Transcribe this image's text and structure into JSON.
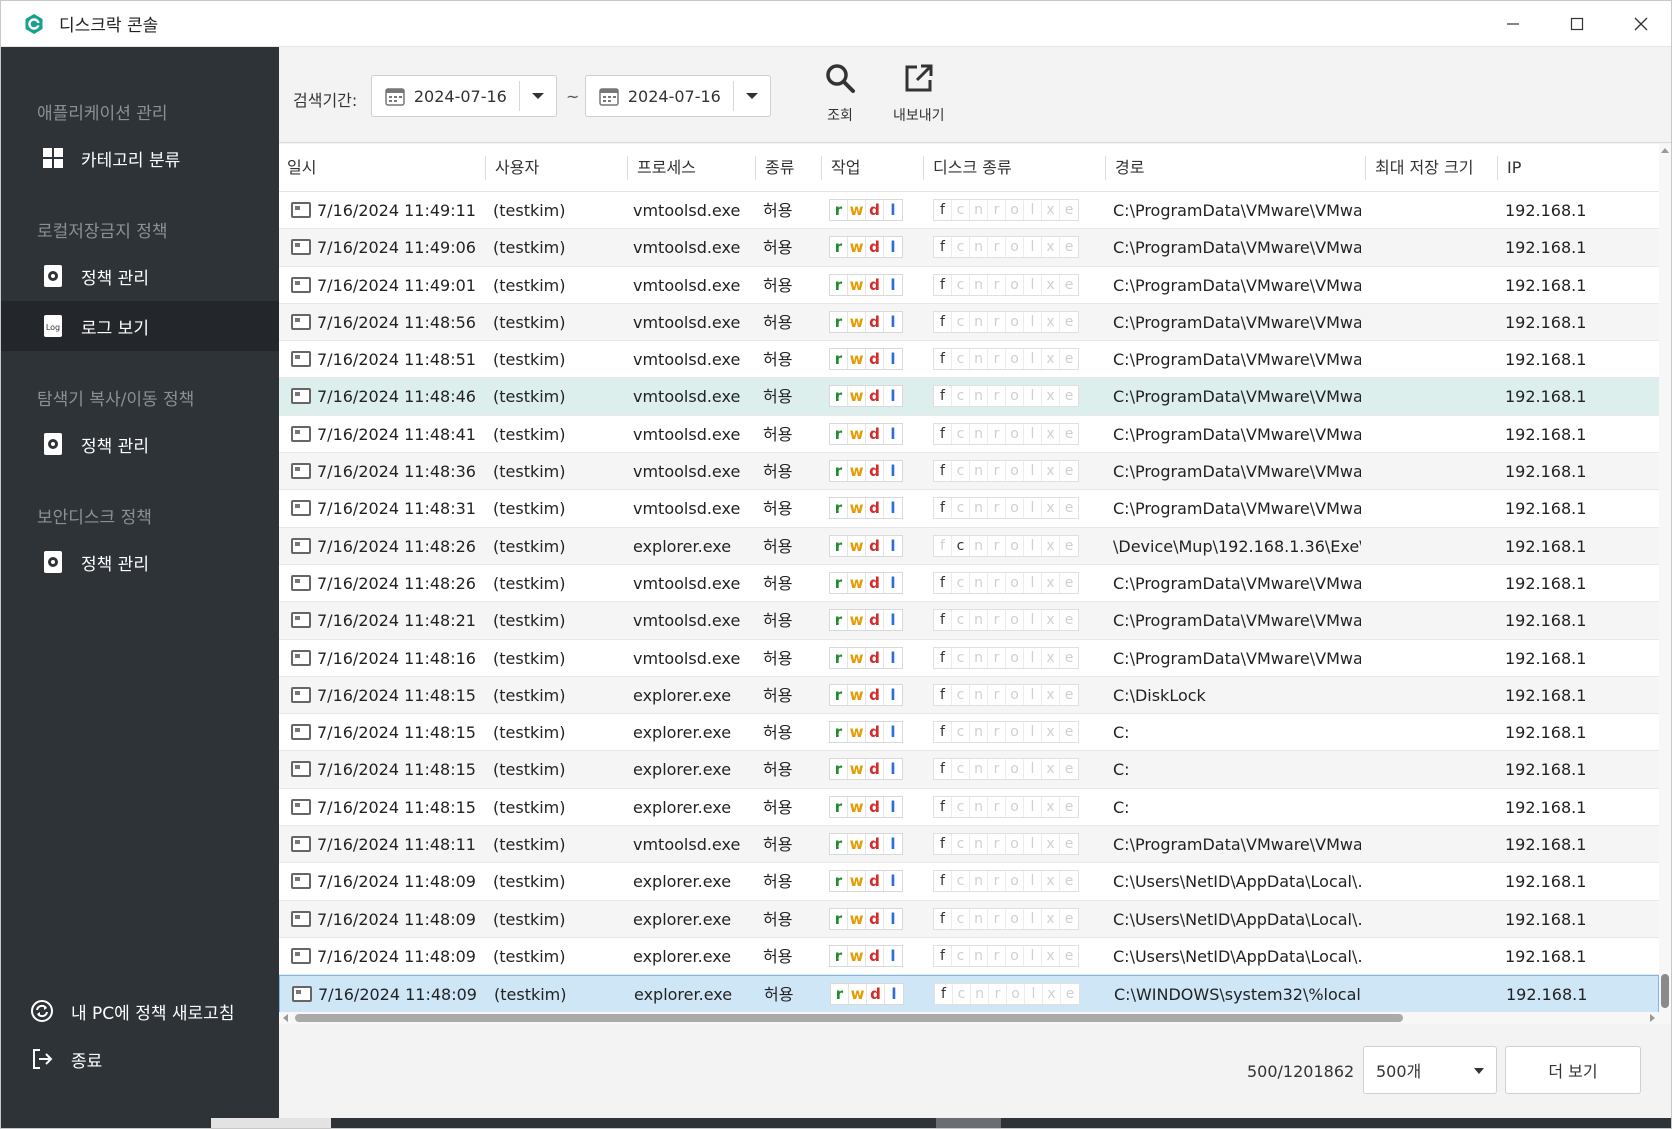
{
  "window": {
    "title": "디스크락 콘솔",
    "accent": "#1aa08f"
  },
  "sidebar": {
    "sections": [
      {
        "label": "애플리케이션 관리",
        "items": [
          {
            "label": "카테고리 분류",
            "icon": "grid-icon"
          }
        ]
      },
      {
        "label": "로컬저장금지 정책",
        "items": [
          {
            "label": "정책 관리",
            "icon": "gear-doc-icon"
          },
          {
            "label": "로그 보기",
            "icon": "log-icon",
            "active": true
          }
        ]
      },
      {
        "label": "탐색기 복사/이동 정책",
        "items": [
          {
            "label": "정책 관리",
            "icon": "gear-doc-icon"
          }
        ]
      },
      {
        "label": "보안디스크 정책",
        "items": [
          {
            "label": "정책 관리",
            "icon": "gear-doc-icon"
          }
        ]
      }
    ],
    "log_icon_text": "Log",
    "footer": [
      {
        "label": "내 PC에 정책 새로고침",
        "icon": "refresh-icon"
      },
      {
        "label": "종료",
        "icon": "exit-icon"
      }
    ]
  },
  "toolbar": {
    "period_label": "검색기간:",
    "start_date": "2024-07-16",
    "end_date": "2024-07-16",
    "tilde": "~",
    "search_label": "조회",
    "export_label": "내보내기"
  },
  "table": {
    "columns": [
      "일시",
      "사용자",
      "프로세스",
      "종류",
      "작업",
      "디스크 종류",
      "경로",
      "최대 저장 크기",
      "IP"
    ],
    "ops_letters": [
      "r",
      "w",
      "d",
      "l"
    ],
    "disk_letters": [
      "f",
      "c",
      "n",
      "r",
      "o",
      "l",
      "x",
      "e"
    ],
    "rows": [
      {
        "time": "7/16/2024 11:49:11…",
        "user": "(testkim)",
        "process": "vmtoolsd.exe",
        "kind": "허용",
        "disk_on": [
          0
        ],
        "path": "C:\\ProgramData\\VMware\\VMwa…",
        "ip": "192.168.1"
      },
      {
        "time": "7/16/2024 11:49:06…",
        "user": "(testkim)",
        "process": "vmtoolsd.exe",
        "kind": "허용",
        "disk_on": [
          0
        ],
        "path": "C:\\ProgramData\\VMware\\VMwa…",
        "ip": "192.168.1"
      },
      {
        "time": "7/16/2024 11:49:01…",
        "user": "(testkim)",
        "process": "vmtoolsd.exe",
        "kind": "허용",
        "disk_on": [
          0
        ],
        "path": "C:\\ProgramData\\VMware\\VMwa…",
        "ip": "192.168.1"
      },
      {
        "time": "7/16/2024 11:48:56…",
        "user": "(testkim)",
        "process": "vmtoolsd.exe",
        "kind": "허용",
        "disk_on": [
          0
        ],
        "path": "C:\\ProgramData\\VMware\\VMwa…",
        "ip": "192.168.1"
      },
      {
        "time": "7/16/2024 11:48:51…",
        "user": "(testkim)",
        "process": "vmtoolsd.exe",
        "kind": "허용",
        "disk_on": [
          0
        ],
        "path": "C:\\ProgramData\\VMware\\VMwa…",
        "ip": "192.168.1"
      },
      {
        "time": "7/16/2024 11:48:46…",
        "user": "(testkim)",
        "process": "vmtoolsd.exe",
        "kind": "허용",
        "disk_on": [
          0
        ],
        "path": "C:\\ProgramData\\VMware\\VMwa…",
        "ip": "192.168.1",
        "state": "hover"
      },
      {
        "time": "7/16/2024 11:48:41…",
        "user": "(testkim)",
        "process": "vmtoolsd.exe",
        "kind": "허용",
        "disk_on": [
          0
        ],
        "path": "C:\\ProgramData\\VMware\\VMwa…",
        "ip": "192.168.1"
      },
      {
        "time": "7/16/2024 11:48:36…",
        "user": "(testkim)",
        "process": "vmtoolsd.exe",
        "kind": "허용",
        "disk_on": [
          0
        ],
        "path": "C:\\ProgramData\\VMware\\VMwa…",
        "ip": "192.168.1"
      },
      {
        "time": "7/16/2024 11:48:31…",
        "user": "(testkim)",
        "process": "vmtoolsd.exe",
        "kind": "허용",
        "disk_on": [
          0
        ],
        "path": "C:\\ProgramData\\VMware\\VMwa…",
        "ip": "192.168.1"
      },
      {
        "time": "7/16/2024 11:48:26…",
        "user": "(testkim)",
        "process": "explorer.exe",
        "kind": "허용",
        "disk_on": [
          1
        ],
        "path": "\\Device\\Mup\\192.168.1.36\\Exe\\…",
        "ip": "192.168.1"
      },
      {
        "time": "7/16/2024 11:48:26…",
        "user": "(testkim)",
        "process": "vmtoolsd.exe",
        "kind": "허용",
        "disk_on": [
          0
        ],
        "path": "C:\\ProgramData\\VMware\\VMwa…",
        "ip": "192.168.1"
      },
      {
        "time": "7/16/2024 11:48:21…",
        "user": "(testkim)",
        "process": "vmtoolsd.exe",
        "kind": "허용",
        "disk_on": [
          0
        ],
        "path": "C:\\ProgramData\\VMware\\VMwa…",
        "ip": "192.168.1"
      },
      {
        "time": "7/16/2024 11:48:16…",
        "user": "(testkim)",
        "process": "vmtoolsd.exe",
        "kind": "허용",
        "disk_on": [
          0
        ],
        "path": "C:\\ProgramData\\VMware\\VMwa…",
        "ip": "192.168.1"
      },
      {
        "time": "7/16/2024 11:48:15…",
        "user": "(testkim)",
        "process": "explorer.exe",
        "kind": "허용",
        "disk_on": [
          0
        ],
        "path": "C:\\DiskLock",
        "ip": "192.168.1"
      },
      {
        "time": "7/16/2024 11:48:15…",
        "user": "(testkim)",
        "process": "explorer.exe",
        "kind": "허용",
        "disk_on": [
          0
        ],
        "path": "C:",
        "ip": "192.168.1"
      },
      {
        "time": "7/16/2024 11:48:15…",
        "user": "(testkim)",
        "process": "explorer.exe",
        "kind": "허용",
        "disk_on": [
          0
        ],
        "path": "C:",
        "ip": "192.168.1"
      },
      {
        "time": "7/16/2024 11:48:15…",
        "user": "(testkim)",
        "process": "explorer.exe",
        "kind": "허용",
        "disk_on": [
          0
        ],
        "path": "C:",
        "ip": "192.168.1"
      },
      {
        "time": "7/16/2024 11:48:11…",
        "user": "(testkim)",
        "process": "vmtoolsd.exe",
        "kind": "허용",
        "disk_on": [
          0
        ],
        "path": "C:\\ProgramData\\VMware\\VMwa…",
        "ip": "192.168.1"
      },
      {
        "time": "7/16/2024 11:48:09…",
        "user": "(testkim)",
        "process": "explorer.exe",
        "kind": "허용",
        "disk_on": [
          0
        ],
        "path": "C:\\Users\\NetID\\AppData\\Local\\…",
        "ip": "192.168.1"
      },
      {
        "time": "7/16/2024 11:48:09…",
        "user": "(testkim)",
        "process": "explorer.exe",
        "kind": "허용",
        "disk_on": [
          0
        ],
        "path": "C:\\Users\\NetID\\AppData\\Local\\…",
        "ip": "192.168.1"
      },
      {
        "time": "7/16/2024 11:48:09…",
        "user": "(testkim)",
        "process": "explorer.exe",
        "kind": "허용",
        "disk_on": [
          0
        ],
        "path": "C:\\Users\\NetID\\AppData\\Local\\…",
        "ip": "192.168.1"
      },
      {
        "time": "7/16/2024 11:48:09…",
        "user": "(testkim)",
        "process": "explorer.exe",
        "kind": "허용",
        "disk_on": [
          0
        ],
        "path": "C:\\WINDOWS\\system32\\%local…",
        "ip": "192.168.1",
        "state": "selected"
      }
    ]
  },
  "footer": {
    "count": "500/1201862",
    "page_size": "500개",
    "more_label": "더 보기"
  }
}
